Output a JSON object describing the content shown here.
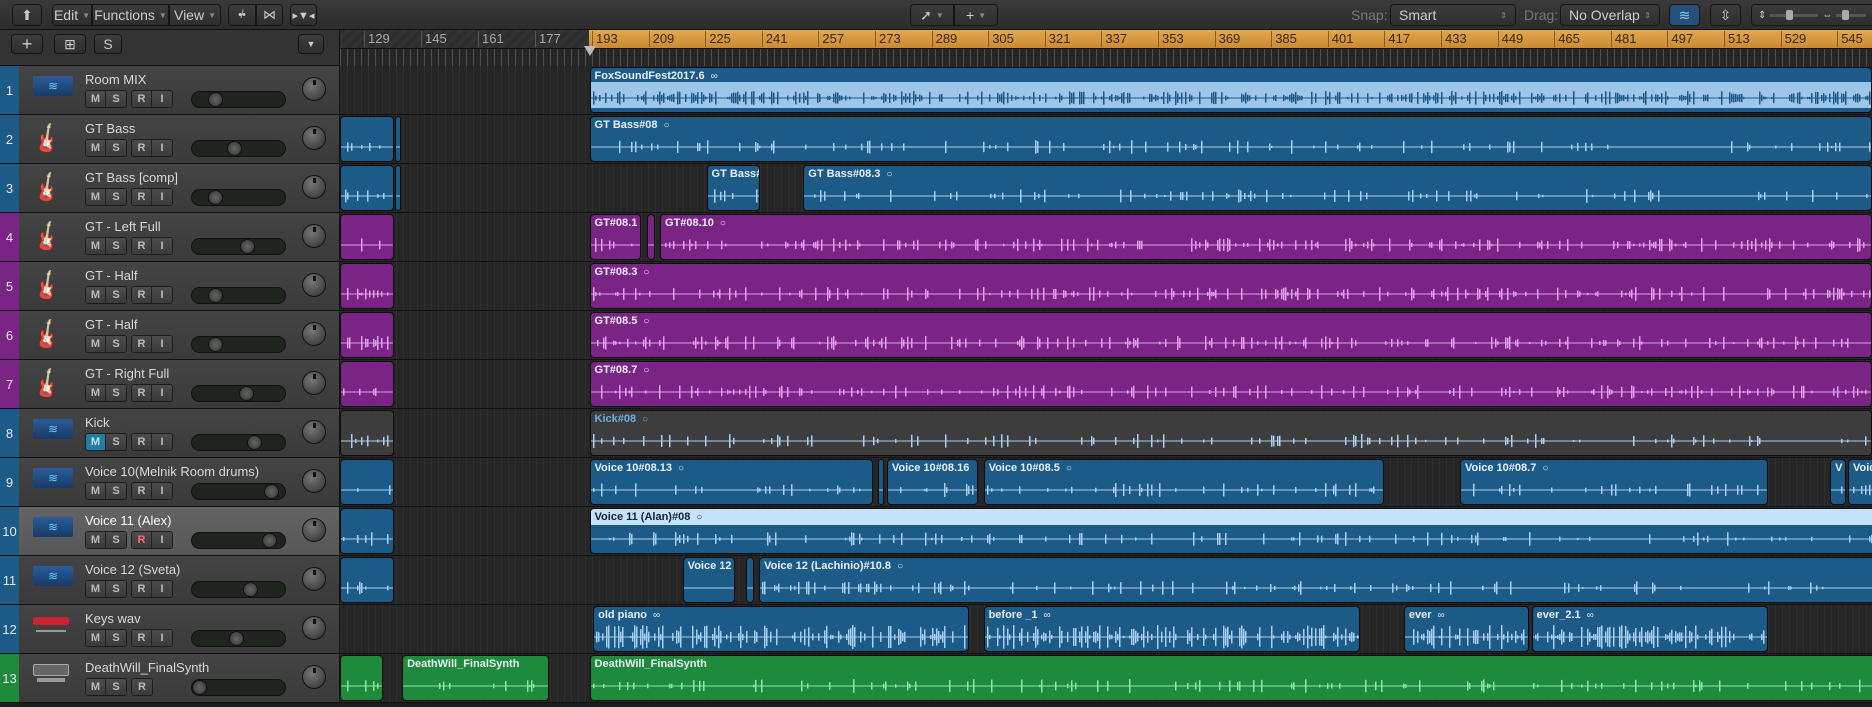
{
  "toolbar": {
    "back_icon": "up-arrow-icon",
    "edit": "Edit",
    "functions": "Functions",
    "view": "View",
    "automation_icon": "automation-icon",
    "flex_icon": "flex-icon",
    "catch_icon": "catch-playhead-icon",
    "pointer_tool_icon": "pointer-icon",
    "crosshair_tool_icon": "crosshair-icon",
    "snap_label": "Snap:",
    "snap_value": "Smart",
    "drag_label": "Drag:",
    "drag_value": "No Overlap",
    "waveform_zoom_icon": "waveform-icon",
    "fit_icon": "vertical-fit-icon",
    "zoom_icons": [
      "vertical-zoom-icon",
      "horizontal-zoom-icon"
    ]
  },
  "header_tools": {
    "add": "+",
    "new_folder_icon": "add-folder-icon",
    "solo_label": "S",
    "menu_icon": "dropdown-icon"
  },
  "ruler": {
    "left_bars": [
      "129",
      "145",
      "161",
      "177"
    ],
    "bars": [
      "193",
      "209",
      "225",
      "241",
      "257",
      "273",
      "289",
      "305",
      "321",
      "337",
      "353",
      "369",
      "385",
      "401",
      "417",
      "433",
      "449",
      "465",
      "481",
      "497",
      "513",
      "529",
      "545"
    ],
    "cycle_color": "#d99a3e"
  },
  "colors": {
    "blue": "#1c5a87",
    "purple": "#7a2585",
    "green": "#1d8a3c",
    "muted": "#3a3a3a"
  },
  "tracks": [
    {
      "number": "1",
      "name": "Room MIX",
      "icon": "audio-waveform-icon",
      "color": "blue",
      "fader": 0.2,
      "buttons": [
        "M",
        "S",
        "R",
        "I"
      ],
      "regions": [
        {
          "name": "FoxSoundFest2017.6",
          "loop": "∞"
        }
      ]
    },
    {
      "number": "2",
      "name": "GT Bass",
      "icon": "bass-guitar-icon",
      "color": "blue",
      "fader": 0.45,
      "buttons": [
        "M",
        "S",
        "R",
        "I"
      ],
      "regions": [
        {
          "name": ""
        },
        {
          "name": ""
        },
        {
          "name": "GT Bass#08",
          "loop": "○"
        }
      ]
    },
    {
      "number": "3",
      "name": "GT Bass [comp]",
      "icon": "bass-guitar-icon",
      "color": "blue",
      "fader": 0.2,
      "buttons": [
        "M",
        "S",
        "R",
        "I"
      ],
      "regions": [
        {
          "name": ""
        },
        {
          "name": ""
        },
        {
          "name": "GT Bass#"
        },
        {
          "name": "GT Bass#08.3",
          "loop": "○"
        }
      ]
    },
    {
      "number": "4",
      "name": "GT - Left Full",
      "icon": "electric-guitar-icon",
      "color": "purple",
      "fader": 0.62,
      "buttons": [
        "M",
        "S",
        "R",
        "I"
      ],
      "regions": [
        {
          "name": ""
        },
        {
          "name": "GT#08.1"
        },
        {
          "name": ""
        },
        {
          "name": "GT#08.10",
          "loop": "○"
        }
      ]
    },
    {
      "number": "5",
      "name": "GT - Half",
      "icon": "electric-guitar-icon",
      "color": "purple",
      "fader": 0.2,
      "buttons": [
        "M",
        "S",
        "R",
        "I"
      ],
      "regions": [
        {
          "name": ""
        },
        {
          "name": "GT#08.3",
          "loop": "○"
        }
      ]
    },
    {
      "number": "6",
      "name": "GT - Half",
      "icon": "electric-guitar-icon",
      "color": "purple",
      "fader": 0.2,
      "buttons": [
        "M",
        "S",
        "R",
        "I"
      ],
      "regions": [
        {
          "name": ""
        },
        {
          "name": "GT#08.5",
          "loop": "○"
        }
      ]
    },
    {
      "number": "7",
      "name": "GT - Right Full",
      "icon": "electric-guitar-icon",
      "color": "purple",
      "fader": 0.6,
      "buttons": [
        "M",
        "S",
        "R",
        "I"
      ],
      "regions": [
        {
          "name": ""
        },
        {
          "name": "GT#08.7",
          "loop": "○"
        }
      ]
    },
    {
      "number": "8",
      "name": "Kick",
      "icon": "audio-waveform-icon",
      "color": "blue",
      "fader": 0.7,
      "muted": true,
      "buttons": [
        "M",
        "S",
        "R",
        "I"
      ],
      "regions": [
        {
          "name": ""
        },
        {
          "name": "Kick#08",
          "loop": "○"
        }
      ]
    },
    {
      "number": "9",
      "name": "Voice 10(Melnik Room drums)",
      "icon": "audio-waveform-icon",
      "color": "blue",
      "fader": 0.92,
      "buttons": [
        "M",
        "S",
        "R",
        "I"
      ],
      "regions": [
        {
          "name": ""
        },
        {
          "name": "Voice 10#08.13",
          "loop": "○"
        },
        {
          "name": ""
        },
        {
          "name": "Voice 10#08.16"
        },
        {
          "name": "Voice 10#08.5",
          "loop": "○"
        },
        {
          "name": "Voice 10#08.7",
          "loop": "○"
        },
        {
          "name": "V"
        },
        {
          "name": "Voic"
        }
      ]
    },
    {
      "number": "10",
      "name": "Voice 11 (Alex)",
      "icon": "audio-waveform-icon",
      "color": "blue",
      "fader": 0.9,
      "selected": true,
      "record_armed": true,
      "buttons": [
        "M",
        "S",
        "R",
        "I"
      ],
      "regions": [
        {
          "name": ""
        },
        {
          "name": "Voice 11 (Alan)#08",
          "loop": "○"
        }
      ]
    },
    {
      "number": "11",
      "name": "Voice 12 (Sveta)",
      "icon": "audio-waveform-icon",
      "color": "blue",
      "fader": 0.66,
      "buttons": [
        "M",
        "S",
        "R",
        "I"
      ],
      "regions": [
        {
          "name": ""
        },
        {
          "name": "Voice 12"
        },
        {
          "name": ""
        },
        {
          "name": "Voice 12 (Lachinio)#10.8",
          "loop": "○"
        }
      ]
    },
    {
      "number": "12",
      "name": "Keys wav",
      "icon": "keyboard-icon",
      "color": "blue",
      "fader": 0.48,
      "buttons": [
        "M",
        "S",
        "R",
        "I"
      ],
      "regions": [
        {
          "name": "old piano",
          "loop": "∞"
        },
        {
          "name": "before _1",
          "loop": "∞"
        },
        {
          "name": "ever",
          "loop": "∞"
        },
        {
          "name": "ever_2.1",
          "loop": "∞"
        }
      ]
    },
    {
      "number": "13",
      "name": "DeathWill_FinalSynth",
      "icon": "synth-keyboard-icon",
      "color": "green",
      "fader": 0.0,
      "buttons": [
        "M",
        "S",
        "R"
      ],
      "regions": [
        {
          "name": ""
        },
        {
          "name": "DeathWill_FinalSynth"
        },
        {
          "name": "DeathWill_FinalSynth"
        }
      ]
    }
  ]
}
